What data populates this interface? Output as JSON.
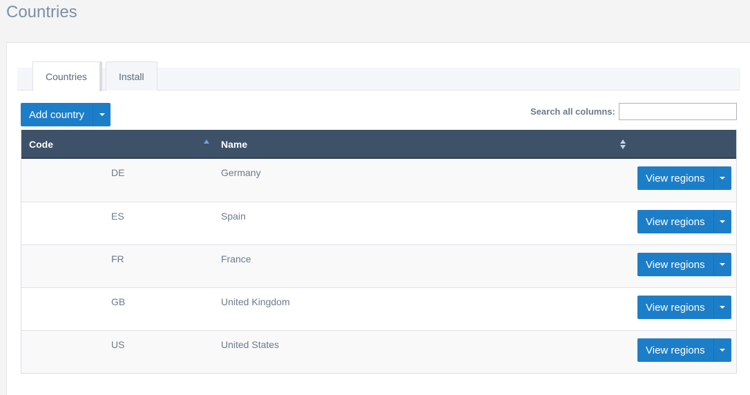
{
  "page": {
    "title": "Countries"
  },
  "tabs": [
    {
      "label": "Countries",
      "active": true
    },
    {
      "label": "Install",
      "active": false
    }
  ],
  "toolbar": {
    "add_label": "Add country",
    "search_label": "Search all columns:",
    "search_value": ""
  },
  "table": {
    "columns": [
      "Code",
      "Name"
    ],
    "sorted_column": "Code",
    "sort_direction": "ascending",
    "action_label": "View regions",
    "rows": [
      {
        "code": "DE",
        "name": "Germany"
      },
      {
        "code": "ES",
        "name": "Spain"
      },
      {
        "code": "FR",
        "name": "France"
      },
      {
        "code": "GB",
        "name": "United Kingdom"
      },
      {
        "code": "US",
        "name": "United States"
      }
    ]
  },
  "colors": {
    "primary": "#1c7ec9",
    "header_bg": "#3d5269",
    "title": "#7d8fa6"
  }
}
